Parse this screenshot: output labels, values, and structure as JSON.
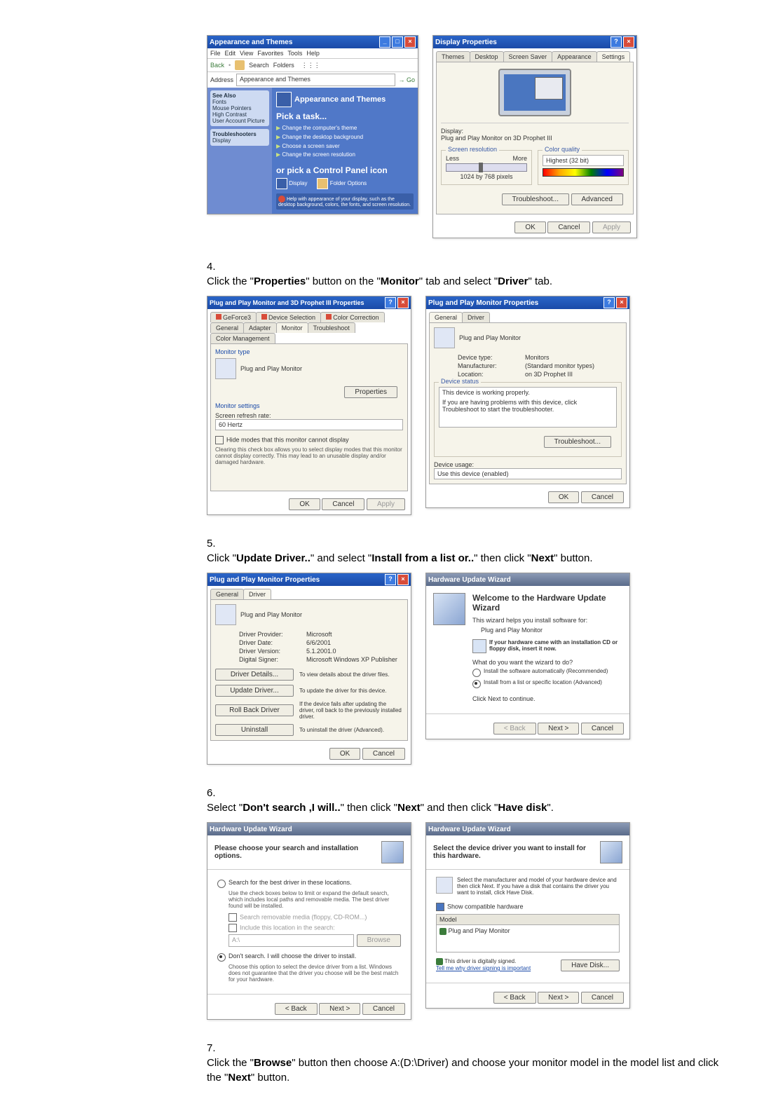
{
  "pair1": {
    "left": {
      "title": "Appearance and Themes",
      "menu": [
        "File",
        "Edit",
        "View",
        "Favorites",
        "Tools",
        "Help"
      ],
      "toolbar_back": "Back",
      "toolbar_search": "Search",
      "toolbar_folders": "Folders",
      "address_label": "Address",
      "address_value": "Appearance and Themes",
      "side_seealso": "See Also",
      "side_items": [
        "Fonts",
        "Mouse Pointers",
        "High Contrast",
        "User Account Picture"
      ],
      "side_trouble": "Troubleshooters",
      "side_t_items": [
        "Display"
      ],
      "cat_title": "Appearance and Themes",
      "pick_task": "Pick a task...",
      "task1": "Change the computer's theme",
      "task2": "Change the desktop background",
      "task3": "Choose a screen saver",
      "task4": "Change the screen resolution",
      "or_pick": "or pick a Control Panel icon",
      "cp1": "Display",
      "cp2": "Folder Options",
      "troubleshoot_text": "Help with appearance of your display, such as the desktop background, colors, the fonts, and screen resolution."
    },
    "right": {
      "title": "Display Properties",
      "tabs": [
        "Themes",
        "Desktop",
        "Screen Saver",
        "Appearance",
        "Settings"
      ],
      "display_lbl": "Display:",
      "display_val": "Plug and Play Monitor on 3D Prophet III",
      "res_lbl": "Screen resolution",
      "res_less": "Less",
      "res_more": "More",
      "res_val": "1024 by 768 pixels",
      "color_lbl": "Color quality",
      "color_val": "Highest (32 bit)",
      "troubleshoot": "Troubleshoot...",
      "advanced": "Advanced",
      "ok": "OK",
      "cancel": "Cancel",
      "apply": "Apply"
    }
  },
  "step4": {
    "n": "4.",
    "t1": "Click the \"",
    "b1": "Properties",
    "t2": "\" button on the \"",
    "b2": "Monitor",
    "t3": "\" tab and select \"",
    "b3": "Driver",
    "t4": "\" tab."
  },
  "pair2": {
    "left": {
      "title": "Plug and Play Monitor and 3D Prophet III Properties",
      "toptabs": [
        "GeForce3",
        "Device Selection",
        "Color Correction"
      ],
      "bottabs": [
        "General",
        "Adapter",
        "Monitor",
        "Troubleshoot",
        "Color Management"
      ],
      "montype_lbl": "Monitor type",
      "montype_val": "Plug and Play Monitor",
      "properties": "Properties",
      "settings_lbl": "Monitor settings",
      "refresh_lbl": "Screen refresh rate:",
      "refresh_val": "60 Hertz",
      "hide_chk": "Hide modes that this monitor cannot display",
      "hide_desc": "Clearing this check box allows you to select display modes that this monitor cannot display correctly. This may lead to an unusable display and/or damaged hardware.",
      "ok": "OK",
      "cancel": "Cancel",
      "apply": "Apply"
    },
    "right": {
      "title": "Plug and Play Monitor Properties",
      "tabs": [
        "General",
        "Driver"
      ],
      "name": "Plug and Play Monitor",
      "dt_lbl": "Device type:",
      "dt_val": "Monitors",
      "mf_lbl": "Manufacturer:",
      "mf_val": "(Standard monitor types)",
      "loc_lbl": "Location:",
      "loc_val": "on 3D Prophet III",
      "status_lbl": "Device status",
      "status_txt": "This device is working properly.",
      "status_hint": "If you are having problems with this device, click Troubleshoot to start the troubleshooter.",
      "troubleshoot": "Troubleshoot...",
      "usage_lbl": "Device usage:",
      "usage_val": "Use this device (enabled)",
      "ok": "OK",
      "cancel": "Cancel"
    }
  },
  "step5": {
    "n": "5.",
    "t1": "Click \"",
    "b1": "Update Driver..",
    "t2": "\" and select \"",
    "b2": "Install from a list or..",
    "t3": "\" then click \"",
    "b3": "Next",
    "t4": "\" button."
  },
  "pair3": {
    "left": {
      "title": "Plug and Play Monitor Properties",
      "tabs": [
        "General",
        "Driver"
      ],
      "name": "Plug and Play Monitor",
      "dp_lbl": "Driver Provider:",
      "dp_val": "Microsoft",
      "dd_lbl": "Driver Date:",
      "dd_val": "6/6/2001",
      "dv_lbl": "Driver Version:",
      "dv_val": "5.1.2001.0",
      "ds_lbl": "Digital Signer:",
      "ds_val": "Microsoft Windows XP Publisher",
      "b_details": "Driver Details...",
      "b_details_d": "To view details about the driver files.",
      "b_update": "Update Driver...",
      "b_update_d": "To update the driver for this device.",
      "b_roll": "Roll Back Driver",
      "b_roll_d": "If the device fails after updating the driver, roll back to the previously installed driver.",
      "b_uninstall": "Uninstall",
      "b_uninstall_d": "To uninstall the driver (Advanced).",
      "ok": "OK",
      "cancel": "Cancel"
    },
    "right": {
      "title": "Hardware Update Wizard",
      "welcome": "Welcome to the Hardware Update Wizard",
      "intro": "This wizard helps you install software for:",
      "device": "Plug and Play Monitor",
      "cd_hint": "If your hardware came with an installation CD or floppy disk, insert it now.",
      "q": "What do you want the wizard to do?",
      "opt1": "Install the software automatically (Recommended)",
      "opt2": "Install from a list or specific location (Advanced)",
      "cont": "Click Next to continue.",
      "back": "< Back",
      "next": "Next >",
      "cancel": "Cancel"
    }
  },
  "step6": {
    "n": "6.",
    "t1": "Select \"",
    "b1": "Don't search ,I will..",
    "t2": "\" then click \"",
    "b2": "Next",
    "t3": "\" and then click \"",
    "b3": "Have disk",
    "t4": "\"."
  },
  "pair4": {
    "left": {
      "title": "Hardware Update Wizard",
      "header": "Please choose your search and installation options.",
      "opt1": "Search for the best driver in these locations.",
      "opt1d": "Use the check boxes below to limit or expand the default search, which includes local paths and removable media. The best driver found will be installed.",
      "c1": "Search removable media (floppy, CD-ROM...)",
      "c2": "Include this location in the search:",
      "path": "A:\\",
      "browse": "Browse",
      "opt2": "Don't search. I will choose the driver to install.",
      "opt2d": "Choose this option to select the device driver from a list. Windows does not guarantee that the driver you choose will be the best match for your hardware.",
      "back": "< Back",
      "next": "Next >",
      "cancel": "Cancel"
    },
    "right": {
      "title": "Hardware Update Wizard",
      "header": "Select the device driver you want to install for this hardware.",
      "desc": "Select the manufacturer and model of your hardware device and then click Next. If you have a disk that contains the driver you want to install, click Have Disk.",
      "compat": "Show compatible hardware",
      "model_lbl": "Model",
      "model_val": "Plug and Play Monitor",
      "signed": "This driver is digitally signed.",
      "tell": "Tell me why driver signing is important",
      "havedisk": "Have Disk...",
      "back": "< Back",
      "next": "Next >",
      "cancel": "Cancel"
    }
  },
  "step7": {
    "n": "7.",
    "t1": "Click the \"",
    "b1": "Browse",
    "t2": "\" button then choose A:(D:\\Driver) and choose your monitor model in the model list and click the \"",
    "b2": "Next",
    "t3": "\" button."
  }
}
